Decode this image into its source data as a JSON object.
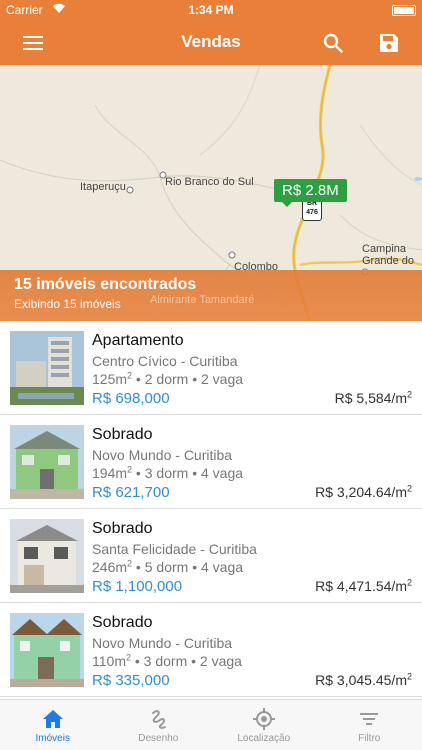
{
  "status_bar": {
    "carrier": "Carrier",
    "time": "1:34 PM"
  },
  "header": {
    "title": "Vendas",
    "icons": [
      "menu-icon",
      "search-icon",
      "save-icon"
    ]
  },
  "map": {
    "labels": {
      "itaperucu": "Itaperuçu",
      "rio_branco": "Rio Branco do Sul",
      "campina": "Campina",
      "grande_do": "Grande do",
      "colombo": "Colombo",
      "almirante": "Almirante Tamandaré"
    },
    "highway_shield": {
      "top": "BR",
      "bottom": "476"
    },
    "price_marker": "R$ 2.8M",
    "results_count": "15 imóveis encontrados",
    "results_showing": "Exibindo 15 imóveis"
  },
  "listings": [
    {
      "type": "Apartamento",
      "location": "Centro Cívico - Curitiba",
      "area": "125m",
      "area_sup": "2",
      "rooms": " • 2 dorm • 2 vaga",
      "price": "R$ 698,000",
      "price_per_m2": "R$ 5,584/m",
      "price_per_m2_sup": "2"
    },
    {
      "type": "Sobrado",
      "location": "Novo Mundo - Curitiba",
      "area": "194m",
      "area_sup": "2",
      "rooms": " • 3 dorm • 4 vaga",
      "price": "R$ 621,700",
      "price_per_m2": "R$ 3,204.64/m",
      "price_per_m2_sup": "2"
    },
    {
      "type": "Sobrado",
      "location": "Santa Felicidade - Curitiba",
      "area": "246m",
      "area_sup": "2",
      "rooms": " • 5 dorm • 4 vaga",
      "price": "R$ 1,100,000",
      "price_per_m2": "R$ 4,471.54/m",
      "price_per_m2_sup": "2"
    },
    {
      "type": "Sobrado",
      "location": "Novo Mundo - Curitiba",
      "area": "110m",
      "area_sup": "2",
      "rooms": " • 3 dorm • 2 vaga",
      "price": "R$ 335,000",
      "price_per_m2": "R$ 3,045.45/m",
      "price_per_m2_sup": "2"
    }
  ],
  "tabs": [
    {
      "label": "Imóveis",
      "icon": "home-icon",
      "active": true
    },
    {
      "label": "Desenho",
      "icon": "draw-icon",
      "active": false
    },
    {
      "label": "Localização",
      "icon": "location-icon",
      "active": false
    },
    {
      "label": "Filtro",
      "icon": "filter-icon",
      "active": false
    }
  ],
  "colors": {
    "accent": "#e8803a",
    "price_blue": "#2f8fd6",
    "marker_green": "#2e9e43",
    "tab_active": "#1d7ae6"
  }
}
